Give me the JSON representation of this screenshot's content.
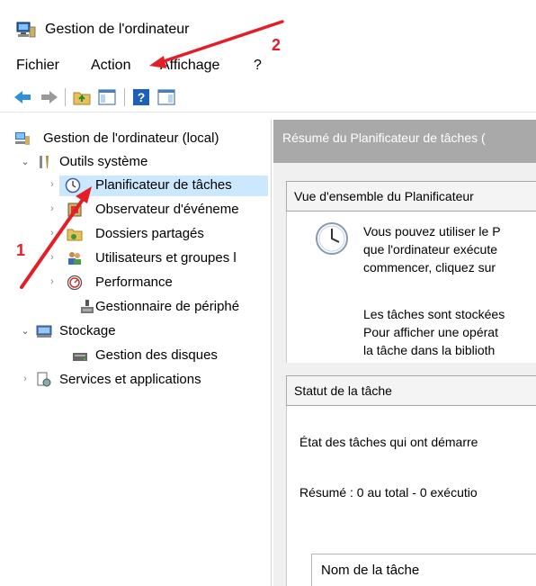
{
  "window": {
    "title": "Gestion de l'ordinateur"
  },
  "menu": {
    "items": [
      "Fichier",
      "Action",
      "Affichage",
      "?"
    ]
  },
  "toolbar": {
    "buttons": [
      "back-icon",
      "forward-icon",
      "up-folder-icon",
      "show-hide-tree-icon",
      "help-icon",
      "action-pane-icon"
    ]
  },
  "tree": {
    "root": "Gestion de l'ordinateur (local)",
    "outils": "Outils système",
    "planificateur": "Planificateur de tâches",
    "observateur": "Observateur d'événeme",
    "dossiers": "Dossiers partagés",
    "utilisateurs": "Utilisateurs et groupes l",
    "performance": "Performance",
    "gestionnaire": "Gestionnaire de périphé",
    "stockage": "Stockage",
    "disques": "Gestion des disques",
    "services": "Services et applications"
  },
  "content": {
    "header": "Résumé du Planificateur de tâches (",
    "overview_title": "Vue d'ensemble du Planificateur",
    "overview_p1": [
      "Vous pouvez utiliser le P",
      "que l'ordinateur exécute",
      "commencer, cliquez sur"
    ],
    "overview_p2": [
      "Les tâches sont stockées",
      "Pour afficher une opérat",
      "la tâche dans la biblioth"
    ],
    "status_title": "Statut de la tâche",
    "status_line": "État des tâches qui ont démarre",
    "summary_line": "Résumé : 0 au total - 0 exécutio",
    "table_col": "Nom de la tâche"
  },
  "annotations": {
    "one": "1",
    "two": "2",
    "color": "#e41e26"
  }
}
